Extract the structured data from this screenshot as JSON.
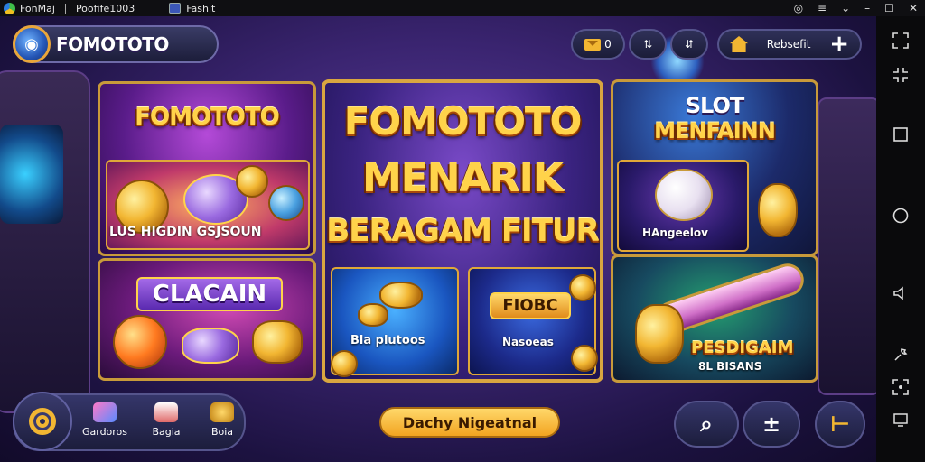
{
  "titlebar": {
    "app_name": "FonMaj",
    "app_sub": "Poofife1003",
    "tab_label": "Fashit",
    "controls": [
      "◎",
      "≡",
      "⌄",
      "–",
      "☐",
      "✕"
    ]
  },
  "header": {
    "brand": "FOMOTOTO",
    "mail_count": "0",
    "pill2_label": "⇅",
    "pill3_label": "⇵",
    "home_label": "Rebsefit",
    "add_label": "+"
  },
  "panels": {
    "left_top": {
      "title": "FOMOTOTO",
      "caption": "LUS HIGDIN GSJSOUN"
    },
    "left_bottom": {
      "title": "CLACAIN"
    },
    "center": {
      "title1": "FOMOTOTO",
      "title2": "MENARIK",
      "title3": "BERAGAM FITUR",
      "sub_left": "Bla plutoos",
      "sub_right_title": "FIOBC",
      "sub_right": "Nasoeas"
    },
    "right_top": {
      "title1": "SLOT",
      "title2": "MENFAINN",
      "caption": "HAngeelov"
    },
    "right_bottom": {
      "title": "PESDIGAIM",
      "caption": "8L BISANS"
    }
  },
  "bottom": {
    "items": [
      {
        "label": "Gardoros"
      },
      {
        "label": "Bagia"
      },
      {
        "label": "Boia"
      }
    ],
    "notice": "Dachy Nigeatnal",
    "btn1": "⌕",
    "btn2": "±",
    "btn3": "⊢"
  },
  "sidebar": {
    "icons": [
      "expand-icon",
      "compress-icon",
      "square-icon",
      "circle-icon",
      "volume-icon",
      "wrench-icon",
      "settings-icon",
      "screen-icon"
    ]
  },
  "colors": {
    "gold": "#ffd34a",
    "panel_border": "#c89a3a",
    "bg": "#3a2470"
  }
}
